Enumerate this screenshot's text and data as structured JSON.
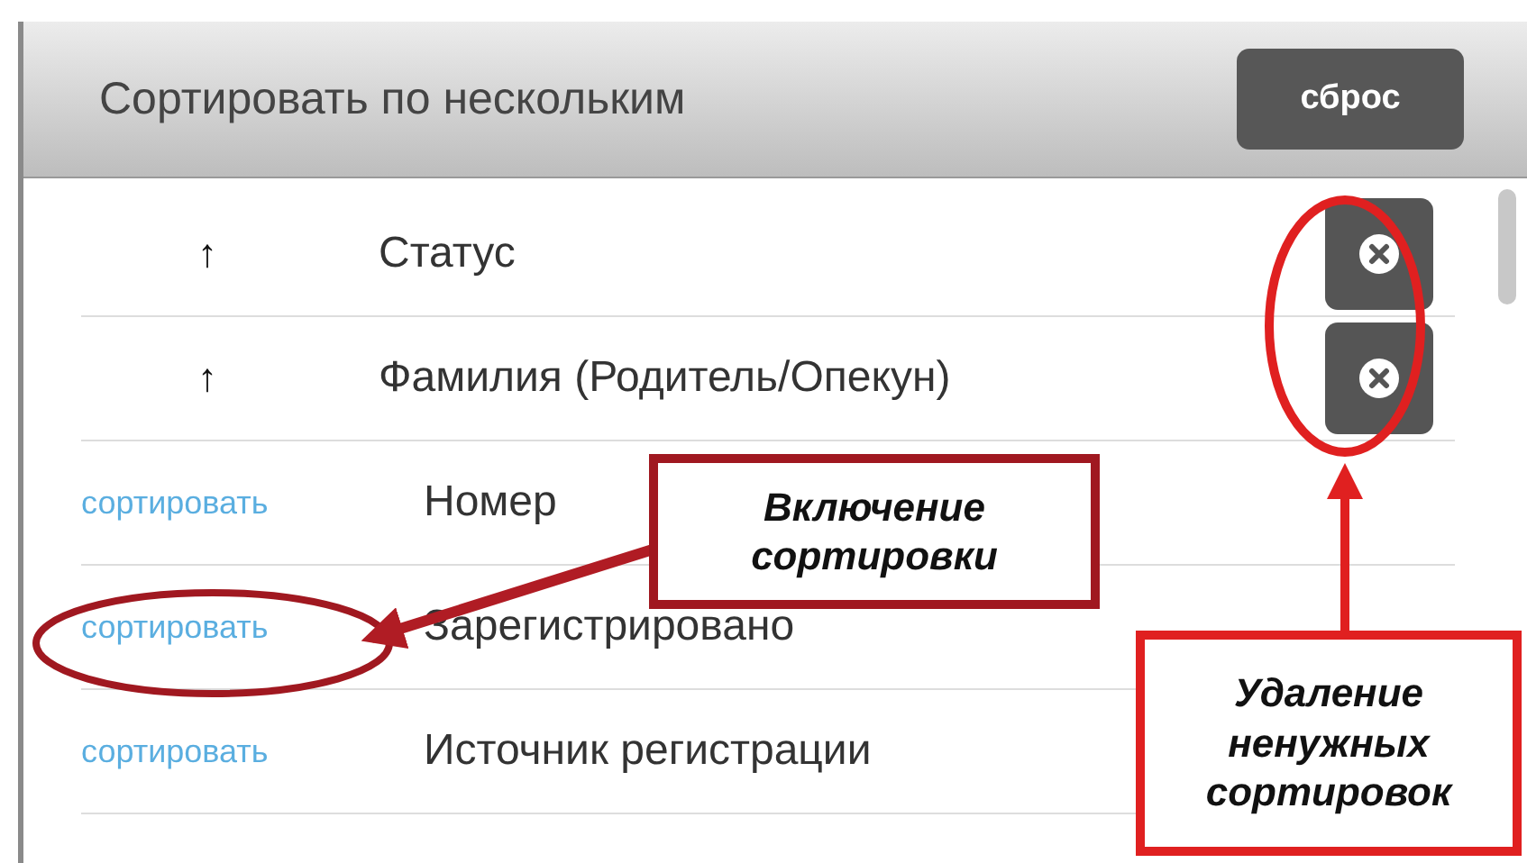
{
  "panel": {
    "title": "Сортировать по нескольким",
    "reset_button": "сброс"
  },
  "rows": [
    {
      "kind": "sorted",
      "direction": "↑",
      "label": "Статус"
    },
    {
      "kind": "sorted",
      "direction": "↑",
      "label": "Фамилия (Родитель/Опекун)"
    },
    {
      "kind": "unsorted",
      "link": "сортировать",
      "label": "Номер"
    },
    {
      "kind": "unsorted",
      "link": "сортировать",
      "label": "Зарегистрировано"
    },
    {
      "kind": "unsorted",
      "link": "сортировать",
      "label": "Источник регистрации"
    }
  ],
  "callouts": [
    {
      "text": "Включение сортировки"
    },
    {
      "text": "Удаление ненужных сортировок"
    }
  ]
}
